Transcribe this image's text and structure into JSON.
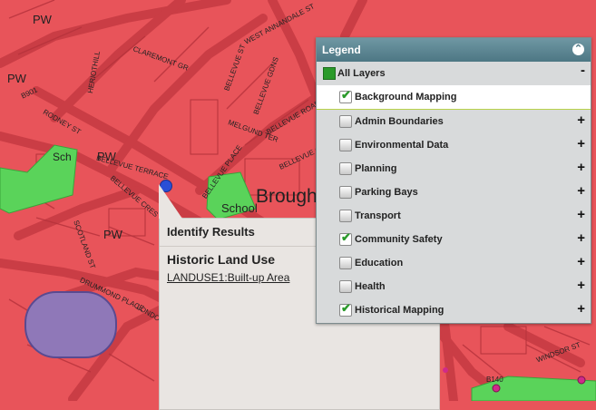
{
  "map": {
    "labels": {
      "pw1": "PW",
      "pw2": "PW",
      "pw3": "PW",
      "sch": "Sch",
      "school": "School",
      "brough": "Brough",
      "b1": "B901",
      "b2": "B140",
      "claremont": "CLAREMONT GR",
      "bellevue_terrace": "BELLEVUE TERRACE",
      "bellevue_cres": "BELLEVUE CRES",
      "scotland_st": "SCOTLAND ST",
      "drummond": "DRUMMOND PLACE",
      "rodney": "RODNEY ST",
      "melgund": "MELGUND TER",
      "windsor": "WINDSOR ST",
      "annandale": "WEST ANNANDALE ST",
      "bellevue_st": "BELLEVUE ST",
      "bellevue_rd": "BELLEVUE ROAD",
      "bellevue_green": "BELLEVUE GREEN",
      "bellevue_gdns": "BELLEVUE GDNS",
      "bellevue_place": "BELLEVUE PLACE",
      "herbert": "HERIOTHILL",
      "london": "LONDON ST"
    },
    "colors": {
      "land": "#e8545a",
      "road": "#c93c44",
      "green": "#5ad35a",
      "blue": "#8f78b8"
    }
  },
  "legend": {
    "title": "Legend",
    "all_layers": "All Layers",
    "all_toggle": "-",
    "layers": [
      {
        "label": "Background Mapping",
        "checked": true,
        "toggle": ""
      },
      {
        "label": "Admin Boundaries",
        "checked": false,
        "toggle": "+"
      },
      {
        "label": "Environmental Data",
        "checked": false,
        "toggle": "+"
      },
      {
        "label": "Planning",
        "checked": false,
        "toggle": "+"
      },
      {
        "label": "Parking Bays",
        "checked": false,
        "toggle": "+"
      },
      {
        "label": "Transport",
        "checked": false,
        "toggle": "+"
      },
      {
        "label": "Community Safety",
        "checked": true,
        "toggle": "+"
      },
      {
        "label": "Education",
        "checked": false,
        "toggle": "+"
      },
      {
        "label": "Health",
        "checked": false,
        "toggle": "+"
      },
      {
        "label": "Historical Mapping",
        "checked": true,
        "toggle": "+"
      }
    ]
  },
  "identify": {
    "title": "Identify Results",
    "heading": "Historic Land Use",
    "link": "LANDUSE1:Built-up Area"
  }
}
